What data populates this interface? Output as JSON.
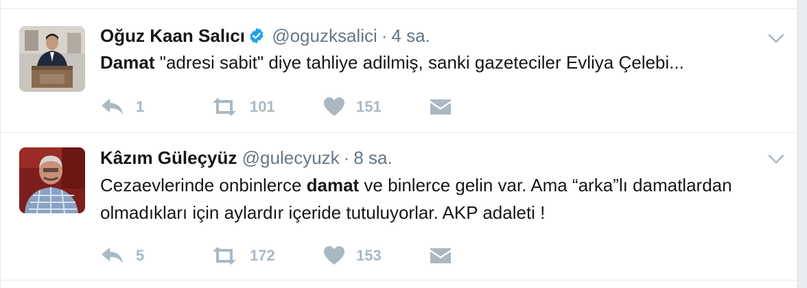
{
  "colors": {
    "accent": "#1da1f2",
    "muted": "#657786",
    "icon": "#aab8c2",
    "text": "#14171a",
    "border": "#e6ecf0"
  },
  "tweets": [
    {
      "name": "Oğuz Kaan Salıcı",
      "verified": true,
      "handle": "@oguzksalici",
      "sep": "·",
      "time": "4 sa.",
      "text_parts": [
        {
          "bold": true,
          "text": "Damat"
        },
        {
          "bold": false,
          "text": " \"adresi sabit\" diye tahliye adilmiş, sanki gazeteciler Evliya Çelebi..."
        }
      ],
      "reply_count": "1",
      "retweet_count": "101",
      "like_count": "151"
    },
    {
      "name": "Kâzım Güleçyüz",
      "verified": false,
      "handle": "@gulecyuzk",
      "sep": "·",
      "time": "8 sa.",
      "text_parts": [
        {
          "bold": false,
          "text": "Cezaevlerinde onbinlerce "
        },
        {
          "bold": true,
          "text": "damat"
        },
        {
          "bold": false,
          "text": " ve binlerce gelin var. Ama “arka”lı damatlardan olmadıkları için aylardır içeride tutuluyorlar. AKP adaleti !"
        }
      ],
      "reply_count": "5",
      "retweet_count": "172",
      "like_count": "153"
    }
  ],
  "icons": {
    "reply": "reply-icon",
    "retweet": "retweet-icon",
    "like": "heart-icon",
    "message": "envelope-icon",
    "more": "chevron-down-icon",
    "verified": "verified-badge-icon"
  }
}
